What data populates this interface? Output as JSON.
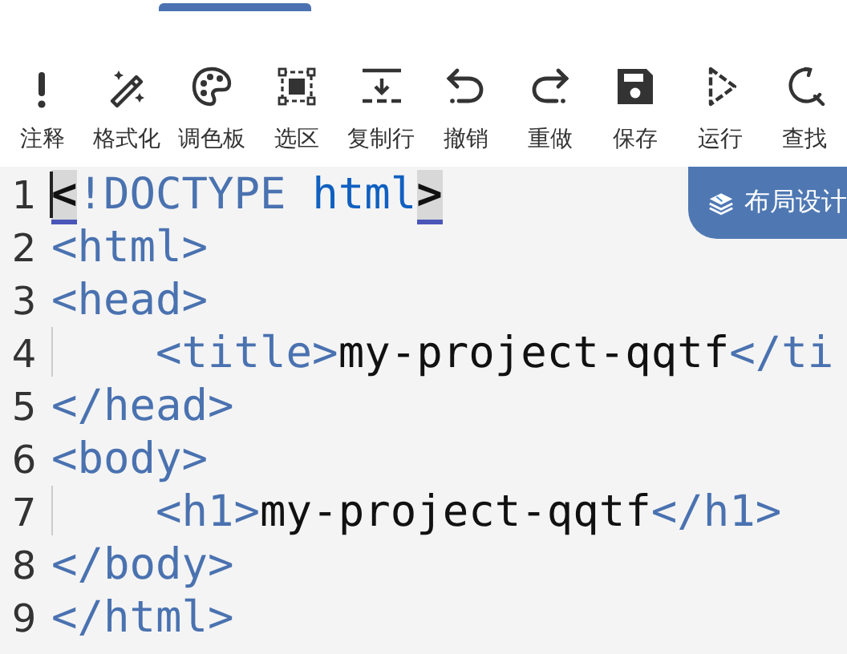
{
  "tab_indicator": {
    "selected": true
  },
  "toolbar": [
    {
      "label": "注释"
    },
    {
      "label": "格式化"
    },
    {
      "label": "调色板"
    },
    {
      "label": "选区"
    },
    {
      "label": "复制行"
    },
    {
      "label": "撤销"
    },
    {
      "label": "重做"
    },
    {
      "label": "保存"
    },
    {
      "label": "运行"
    },
    {
      "label": "查找"
    }
  ],
  "editor": {
    "lines": [
      {
        "number": "1",
        "cursor": true,
        "indent_guide": false,
        "tokens": [
          {
            "kind": "bracket-match",
            "text": "<"
          },
          {
            "kind": "tag",
            "text": "!DOCTYPE "
          },
          {
            "kind": "keyword",
            "text": "html"
          },
          {
            "kind": "bracket-match",
            "text": ">"
          }
        ]
      },
      {
        "number": "2",
        "cursor": false,
        "indent_guide": false,
        "tokens": [
          {
            "kind": "tag",
            "text": "<html>"
          }
        ]
      },
      {
        "number": "3",
        "cursor": false,
        "indent_guide": false,
        "tokens": [
          {
            "kind": "tag",
            "text": "<head>"
          }
        ]
      },
      {
        "number": "4",
        "cursor": false,
        "indent_guide": true,
        "tokens": [
          {
            "kind": "tag",
            "text": "    <title>"
          },
          {
            "kind": "text",
            "text": "my-project-qqtf"
          },
          {
            "kind": "tag",
            "text": "</ti"
          }
        ]
      },
      {
        "number": "5",
        "cursor": false,
        "indent_guide": false,
        "tokens": [
          {
            "kind": "tag",
            "text": "</head>"
          }
        ]
      },
      {
        "number": "6",
        "cursor": false,
        "indent_guide": false,
        "tokens": [
          {
            "kind": "tag",
            "text": "<body>"
          }
        ]
      },
      {
        "number": "7",
        "cursor": false,
        "indent_guide": true,
        "tokens": [
          {
            "kind": "tag",
            "text": "    <h1>"
          },
          {
            "kind": "text",
            "text": "my-project-qqtf"
          },
          {
            "kind": "tag",
            "text": "</h1>"
          }
        ]
      },
      {
        "number": "8",
        "cursor": false,
        "indent_guide": false,
        "tokens": [
          {
            "kind": "tag",
            "text": "</body>"
          }
        ]
      },
      {
        "number": "9",
        "cursor": false,
        "indent_guide": false,
        "tokens": [
          {
            "kind": "tag",
            "text": "</html>"
          }
        ]
      }
    ]
  },
  "layout_designer_button": {
    "label": "布局设计"
  }
}
